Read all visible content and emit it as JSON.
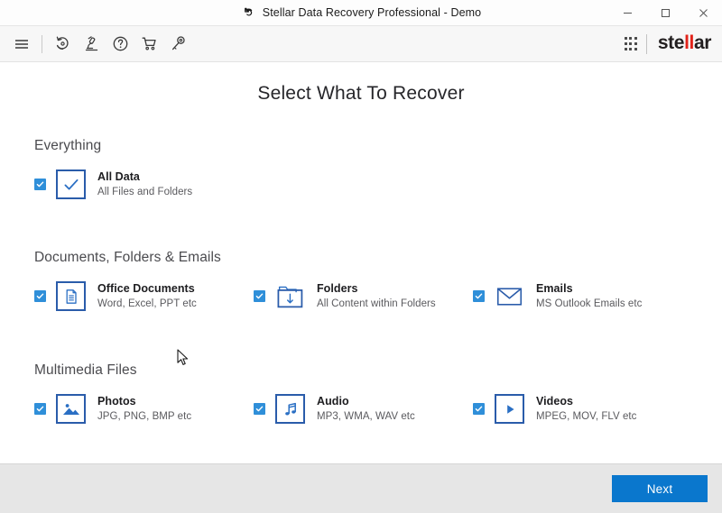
{
  "window": {
    "title": "Stellar Data Recovery Professional - Demo",
    "title_icon": "recovery-arrow-icon",
    "controls": {
      "minimize": "minimize-button",
      "maximize": "maximize-button",
      "close": "close-button"
    }
  },
  "toolbar": {
    "items": [
      {
        "name": "menu-icon",
        "label": "Menu"
      },
      {
        "name": "recovery-history-icon",
        "label": "Recovery"
      },
      {
        "name": "microscope-icon",
        "label": "Deep Scan"
      },
      {
        "name": "help-icon",
        "label": "Help"
      },
      {
        "name": "cart-icon",
        "label": "Buy"
      },
      {
        "name": "key-icon",
        "label": "Activation"
      }
    ],
    "apps_grid": "grid-dots-icon",
    "brand": {
      "prefix": "ste",
      "highlight": "ll",
      "suffix": "ar",
      "accent_color": "#e2231a"
    }
  },
  "main": {
    "page_title": "Select What To Recover",
    "sections": [
      {
        "heading": "Everything",
        "options": [
          {
            "title": "All Data",
            "subtitle": "All Files and Folders",
            "icon": "check-icon",
            "checked": true
          }
        ]
      },
      {
        "heading": "Documents, Folders & Emails",
        "options": [
          {
            "title": "Office Documents",
            "subtitle": "Word, Excel, PPT etc",
            "icon": "document-icon",
            "checked": true
          },
          {
            "title": "Folders",
            "subtitle": "All Content within Folders",
            "icon": "folder-download-icon",
            "checked": true
          },
          {
            "title": "Emails",
            "subtitle": "MS Outlook Emails etc",
            "icon": "envelope-icon",
            "checked": true
          }
        ]
      },
      {
        "heading": "Multimedia Files",
        "options": [
          {
            "title": "Photos",
            "subtitle": "JPG, PNG, BMP etc",
            "icon": "photo-icon",
            "checked": true
          },
          {
            "title": "Audio",
            "subtitle": "MP3, WMA, WAV etc",
            "icon": "music-note-icon",
            "checked": true
          },
          {
            "title": "Videos",
            "subtitle": "MPEG, MOV, FLV etc",
            "icon": "play-icon",
            "checked": true
          }
        ]
      }
    ]
  },
  "footer": {
    "next_label": "Next"
  },
  "colors": {
    "accent_blue": "#0a77cd",
    "checkbox_blue": "#2f8fd9",
    "icon_border_blue": "#2a5caa",
    "brand_red": "#e2231a",
    "toolbar_bg": "#f7f7f7",
    "footer_bg": "#e6e6e6"
  }
}
